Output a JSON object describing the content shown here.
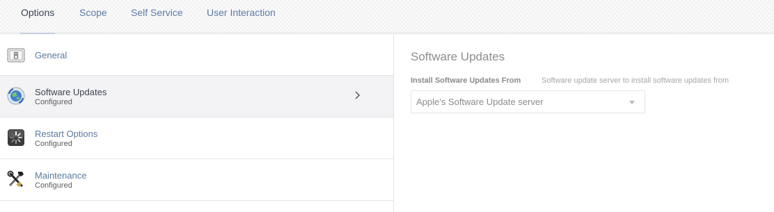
{
  "tabs": [
    {
      "label": "Options",
      "active": true
    },
    {
      "label": "Scope",
      "active": false
    },
    {
      "label": "Self Service",
      "active": false
    },
    {
      "label": "User Interaction",
      "active": false
    }
  ],
  "sidebar": {
    "items": [
      {
        "title": "General",
        "subtitle": "",
        "icon": "switch-icon",
        "selected": false
      },
      {
        "title": "Software Updates",
        "subtitle": "Configured",
        "icon": "software-update-globe-icon",
        "selected": true
      },
      {
        "title": "Restart Options",
        "subtitle": "Configured",
        "icon": "restart-spinner-icon",
        "selected": false
      },
      {
        "title": "Maintenance",
        "subtitle": "Configured",
        "icon": "tools-icon",
        "selected": false
      }
    ]
  },
  "detail": {
    "title": "Software Updates",
    "field_label": "Install Software Updates From",
    "field_help": "Software update server to install software updates from",
    "select_value": "Apple's Software Update server"
  },
  "colors": {
    "link_blue": "#5b79a1",
    "tab_active_underline": "#c4cfde",
    "selected_row_bg": "#f3f3f5"
  }
}
